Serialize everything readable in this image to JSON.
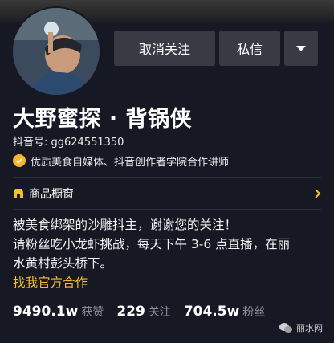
{
  "buttons": {
    "unfollow": "取消关注",
    "message": "私信"
  },
  "profile": {
    "name": "大野蜜探 · 背锅侠",
    "douyin_id": "抖音号: gg624551350",
    "certification": "优质美食自媒体、抖音创作者学院合作讲师"
  },
  "shop": {
    "label": "商品橱窗"
  },
  "bio": {
    "line1": "被美食绑架的沙雕抖主，谢谢您的关注！",
    "line2": "请粉丝吃小龙虾挑战，每天下午 3-6 点直播，在丽",
    "line3": "水黄村彭头桥下。"
  },
  "cooperation_link": "找我官方合作",
  "stats": {
    "likes_value": "9490.1w",
    "likes_label": "获赞",
    "following_value": "229",
    "following_label": "关注",
    "followers_value": "704.5w",
    "followers_label": "粉丝"
  },
  "watermark": "丽水网",
  "colors": {
    "background": "#161823",
    "button": "#393b44",
    "accent_yellow": "#f5c025",
    "muted_text": "#8c8d95"
  },
  "icons": {
    "more": "chevron-down-icon",
    "cert": "verified-badge-icon",
    "shop": "shop-window-icon",
    "shop_arrow": "chevron-right-icon",
    "watermark": "wechat-icon"
  }
}
